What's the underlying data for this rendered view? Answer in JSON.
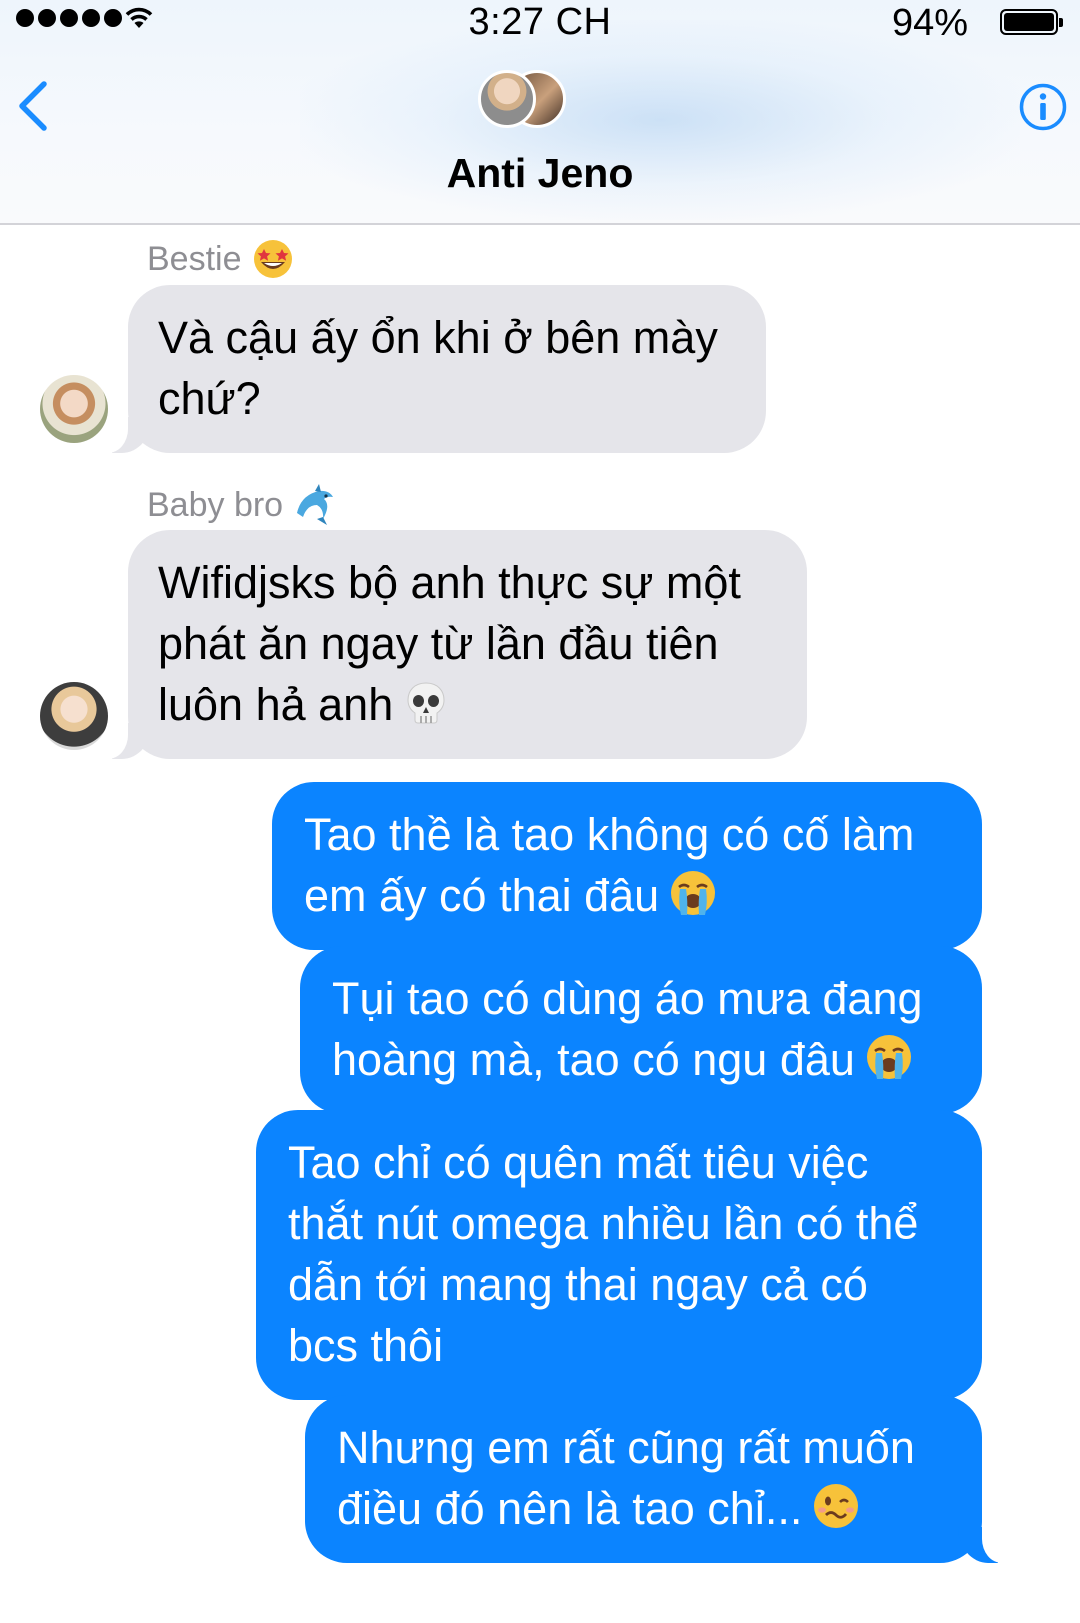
{
  "status_bar": {
    "time": "3:27 CH",
    "battery_percent": "94%",
    "signal_dots": 5
  },
  "header": {
    "title": "Anti Jeno"
  },
  "messages": [
    {
      "direction": "incoming",
      "sender": "Bestie",
      "sender_emoji": "star-struck",
      "text": "Và cậu ấy ổn khi ở bên mày\nchứ?"
    },
    {
      "direction": "incoming",
      "sender": "Baby bro",
      "sender_emoji": "dolphin",
      "text": "Wifidjsks bộ anh thực sự một\nphát ăn ngay từ lần đầu tiên\nluôn hả anh",
      "trailing_emoji": "skull"
    },
    {
      "direction": "outgoing",
      "text": "Tao thề là tao không có cố làm\nem ấy có thai đâu",
      "trailing_emoji": "loudly-crying-face"
    },
    {
      "direction": "outgoing",
      "text": "Tụi tao có dùng áo mưa đang\nhoàng mà, tao có ngu đâu",
      "trailing_emoji": "loudly-crying-face"
    },
    {
      "direction": "outgoing",
      "text": "Tao chỉ có quên mất tiêu việc\nthắt nút omega nhiều lần có thể\ndẫn tới mang thai ngay cả có\nbcs thôi"
    },
    {
      "direction": "outgoing",
      "text": "Nhưng em rất cũng rất muốn\nđiều đó nên là tao chỉ...",
      "trailing_emoji": "woozy-face"
    }
  ],
  "colors": {
    "accent": "#0b84ff",
    "incoming_bubble": "#e5e5ea",
    "sender_label": "#8e8e93",
    "icon_blue": "#1a8cff"
  }
}
